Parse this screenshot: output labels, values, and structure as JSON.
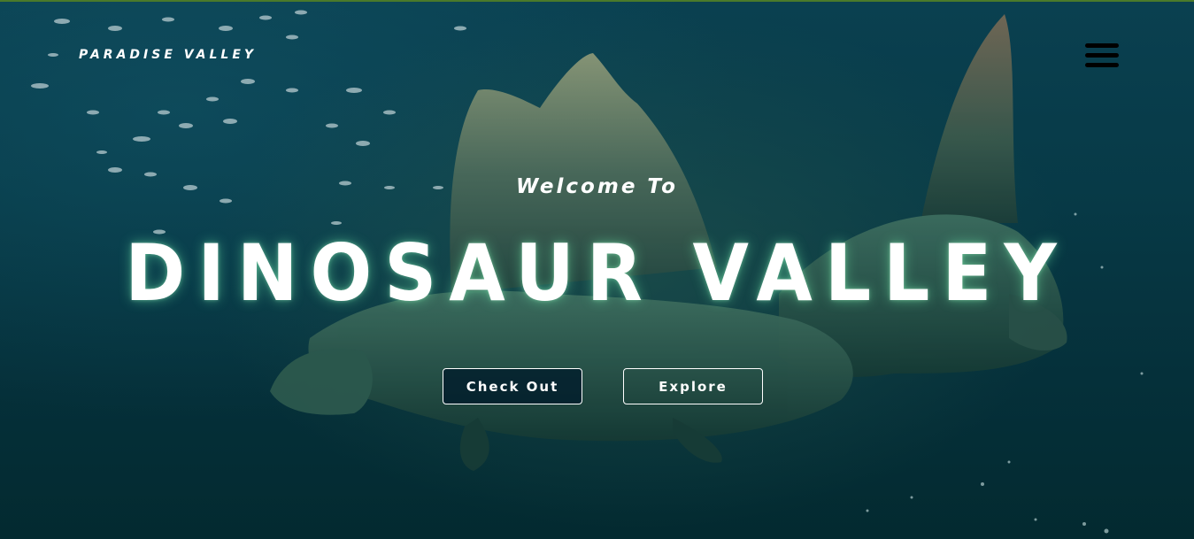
{
  "nav": {
    "brand": "PARADISE VALLEY",
    "menu_icon": "hamburger-menu-icon"
  },
  "hero": {
    "eyebrow": "Welcome To",
    "title": "DINOSAUR VALLEY",
    "background_image": "underwater-spinosaurus-illustration",
    "buttons": {
      "primary_label": "Check Out",
      "secondary_label": "Explore"
    }
  },
  "colors": {
    "background_deep": "#05303a",
    "background_light": "#0a4050",
    "text": "#ffffff",
    "menu_icon": "#000000",
    "top_border": "#4a7a2a"
  }
}
